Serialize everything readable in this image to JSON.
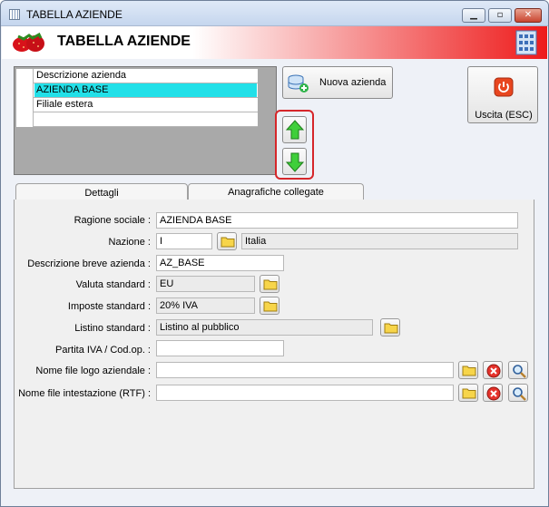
{
  "window": {
    "title": "TABELLA AZIENDE"
  },
  "header": {
    "title": "TABELLA AZIENDE"
  },
  "grid": {
    "column_header": "Descrizione azienda",
    "rows": [
      {
        "label": "AZIENDA BASE",
        "selected": true
      },
      {
        "label": "Filiale estera",
        "selected": false
      }
    ]
  },
  "toolbar": {
    "new_label": "Nuova azienda",
    "exit_label": "Uscita (ESC)"
  },
  "tabs": [
    {
      "label": "Dettagli",
      "active": true
    },
    {
      "label": "Anagrafiche collegate",
      "active": false
    }
  ],
  "form": {
    "ragione_sociale": {
      "label": "Ragione sociale :",
      "value": "AZIENDA BASE"
    },
    "nazione": {
      "label": "Nazione :",
      "code": "I",
      "desc": "Italia"
    },
    "descrizione_breve": {
      "label": "Descrizione breve azienda :",
      "value": "AZ_BASE"
    },
    "valuta": {
      "label": "Valuta standard :",
      "value": "EU"
    },
    "imposte": {
      "label": "Imposte standard :",
      "value": "20% IVA"
    },
    "listino": {
      "label": "Listino standard :",
      "value": "Listino al pubblico"
    },
    "partita_iva": {
      "label": "Partita IVA / Cod.op. :",
      "value": ""
    },
    "logo": {
      "label": "Nome file logo aziendale :",
      "value": ""
    },
    "intestazione": {
      "label": "Nome file intestazione (RTF) :",
      "value": ""
    }
  },
  "colors": {
    "selection": "#22e0e8",
    "header_red": "#ee1a1a",
    "highlight_frame": "#d6262a"
  }
}
